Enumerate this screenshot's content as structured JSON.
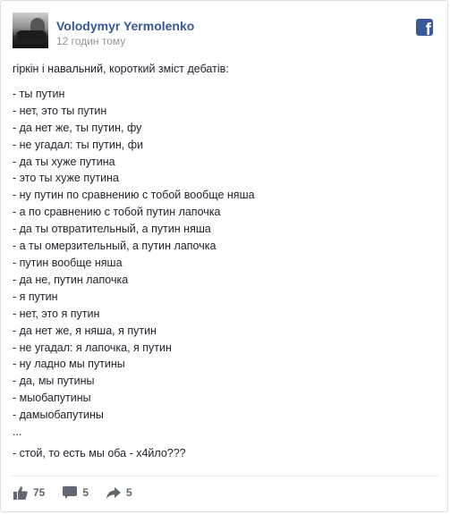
{
  "post": {
    "author": "Volodymyr Yermolenko",
    "timestamp": "12 годин тому",
    "intro": "гіркін і навальний, короткий зміст дебатів:",
    "lines": [
      "- ты путин",
      "- нет, это ты путин",
      "- да нет же, ты путин, фу",
      "- не угадал: ты путин, фи",
      "- да ты хуже путина",
      "- это ты хуже путина",
      "- ну путин по сравнению с тобой вообще няша",
      "- а по сравнению с тобой путин лапочка",
      "- да ты отвратительный, а путин няша",
      "- а ты омерзительный, а путин лапочка",
      "- путин вообще няша",
      "- да не, путин лапочка",
      "- я путин",
      "- нет, это я путин",
      "- да нет же, я няша, я путин",
      "- не угадал: я лапочка, я путин",
      "- ну ладно мы путины",
      "- да, мы путины",
      "- мыобапутины",
      "- дамыобапутины"
    ],
    "ellipsis": "...",
    "final_line": "- стой, то есть мы оба - х4йло???"
  },
  "actions": {
    "likes_count": "75",
    "comments_count": "5",
    "shares_count": "5"
  },
  "icons": {
    "brand": "facebook-icon",
    "like": "thumbs-up-icon",
    "comment": "comment-bubble-icon",
    "share": "share-arrow-icon"
  },
  "colors": {
    "author_link": "#365899",
    "brand": "#3b5998",
    "meta_text": "#90949c",
    "action_text": "#616770"
  }
}
